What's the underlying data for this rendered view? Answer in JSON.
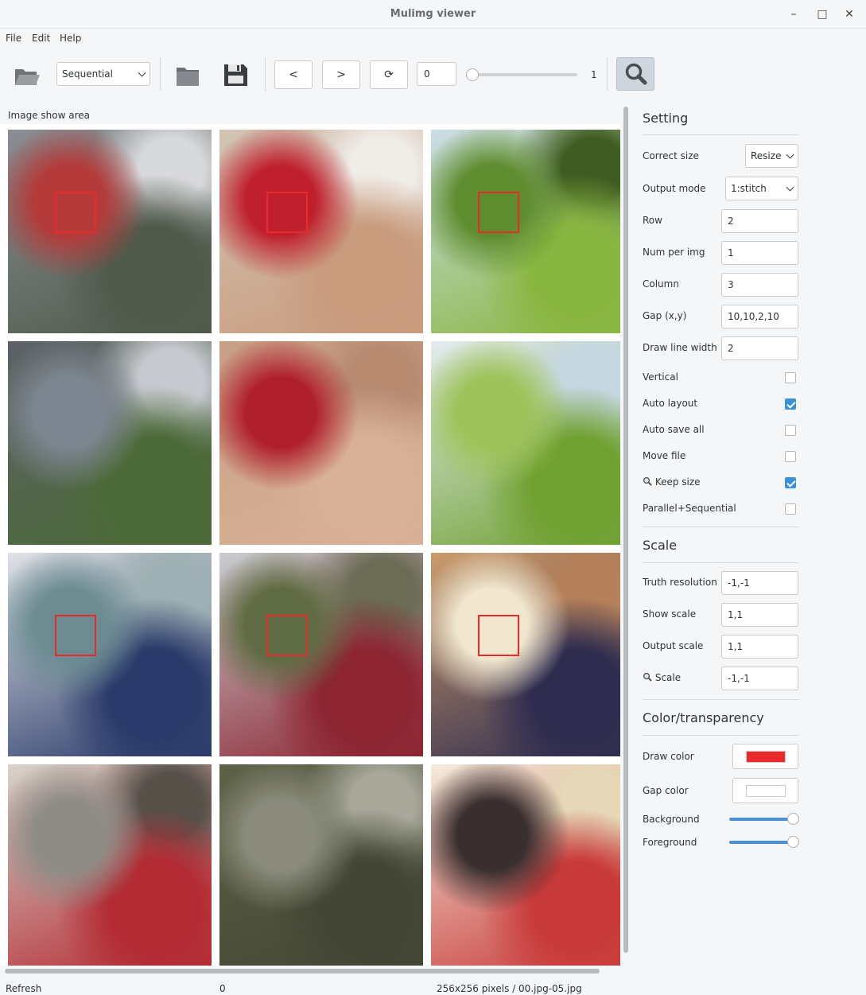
{
  "window": {
    "title": "Mulimg viewer",
    "minimize": "–",
    "maximize": "□",
    "close": "✕"
  },
  "menu": [
    "File",
    "Edit",
    "Help"
  ],
  "toolbar": {
    "open_icon": "folder-open-icon",
    "mode_select": "Sequential",
    "folder_icon": "folder-icon",
    "save_icon": "save-icon",
    "prev_label": "<",
    "next_label": ">",
    "refresh_label": "⟳",
    "index_value": "0",
    "slider_max_label": "1",
    "slider_fraction": 0.0,
    "magnifier_icon": "magnifier-icon"
  },
  "image_area": {
    "label": "Image show area"
  },
  "tiles": [
    {
      "desc": "parade street scene",
      "colors": [
        "#8b8e94",
        "#b53a3a",
        "#4f5a4b",
        "#d8d9dc"
      ],
      "selection": true
    },
    {
      "desc": "red and floral pillow",
      "colors": [
        "#d2c4b4",
        "#c0202e",
        "#c99b7d",
        "#f0ece8"
      ],
      "selection": true
    },
    {
      "desc": "grassy mountain path",
      "colors": [
        "#cbdde6",
        "#5e8c2e",
        "#89b640",
        "#3f5c22"
      ],
      "selection": true
    },
    {
      "desc": "zoom building",
      "colors": [
        "#5d6168",
        "#7d8590",
        "#4b6a37",
        "#c7c9cf"
      ],
      "selection": false
    },
    {
      "desc": "zoom pillow",
      "colors": [
        "#c79f86",
        "#b0202c",
        "#d8b196",
        "#b78a70"
      ],
      "selection": false
    },
    {
      "desc": "zoom grass",
      "colors": [
        "#e4ecf1",
        "#9ec35a",
        "#6fa030",
        "#c6d7e2"
      ],
      "selection": false
    },
    {
      "desc": "indoor atrium",
      "colors": [
        "#dfe2e5",
        "#6c8c92",
        "#2a3a6a",
        "#9fb1b4"
      ],
      "selection": true
    },
    {
      "desc": "bus on road",
      "colors": [
        "#c9cdd1",
        "#5f6b42",
        "#8c2431",
        "#6b6c55"
      ],
      "selection": true
    },
    {
      "desc": "shop facade",
      "colors": [
        "#cc9b6b",
        "#f1e7cf",
        "#2e2c4f",
        "#b5805a"
      ],
      "selection": true
    },
    {
      "desc": "zoom atrium",
      "colors": [
        "#d7d4cc",
        "#8f8c86",
        "#b32a33",
        "#57514a"
      ],
      "selection": false
    },
    {
      "desc": "zoom tree",
      "colors": [
        "#5f6248",
        "#8a8b7a",
        "#434634",
        "#a7a79a"
      ],
      "selection": false
    },
    {
      "desc": "zoom sign",
      "colors": [
        "#f4eddc",
        "#3a2f2f",
        "#c83a3a",
        "#e6d8b8"
      ],
      "selection": false
    }
  ],
  "settings": {
    "title": "Setting",
    "correct_size": {
      "label": "Correct size",
      "value": "Resize"
    },
    "output_mode": {
      "label": "Output mode",
      "value": "1:stitch"
    },
    "row": {
      "label": "Row",
      "value": "2"
    },
    "num_per_img": {
      "label": "Num per img",
      "value": "1"
    },
    "column": {
      "label": "Column",
      "value": "3"
    },
    "gap": {
      "label": "Gap (x,y)",
      "value": "10,10,2,10"
    },
    "draw_line_width": {
      "label": "Draw line width",
      "value": "2"
    },
    "vertical": {
      "label": "Vertical",
      "checked": false
    },
    "auto_layout": {
      "label": "Auto layout",
      "checked": true
    },
    "auto_save_all": {
      "label": "Auto save all",
      "checked": false
    },
    "move_file": {
      "label": "Move file",
      "checked": false
    },
    "keep_size": {
      "label": "Keep size",
      "checked": true,
      "icon": "magnifier-icon"
    },
    "parallel_sequential": {
      "label": "Parallel+Sequential",
      "checked": false
    }
  },
  "scale": {
    "title": "Scale",
    "truth_resolution": {
      "label": "Truth resolution",
      "value": "-1,-1"
    },
    "show_scale": {
      "label": "Show scale",
      "value": "1,1"
    },
    "output_scale": {
      "label": "Output scale",
      "value": "1,1"
    },
    "zoom_scale": {
      "label": "Scale",
      "value": "-1,-1",
      "icon": "magnifier-icon"
    }
  },
  "color": {
    "title": "Color/transparency",
    "draw_color": {
      "label": "Draw  color",
      "value": "#e82a2a"
    },
    "gap_color": {
      "label": "Gap color",
      "value": "#ffffff"
    },
    "background": {
      "label": "Background",
      "fraction": 1.0
    },
    "foreground": {
      "label": "Foreground",
      "fraction": 1.0
    },
    "accent": "#4a90d9"
  },
  "status": {
    "left": "Refresh",
    "middle": "0",
    "right": "256x256 pixels / 00.jpg-05.jpg"
  }
}
